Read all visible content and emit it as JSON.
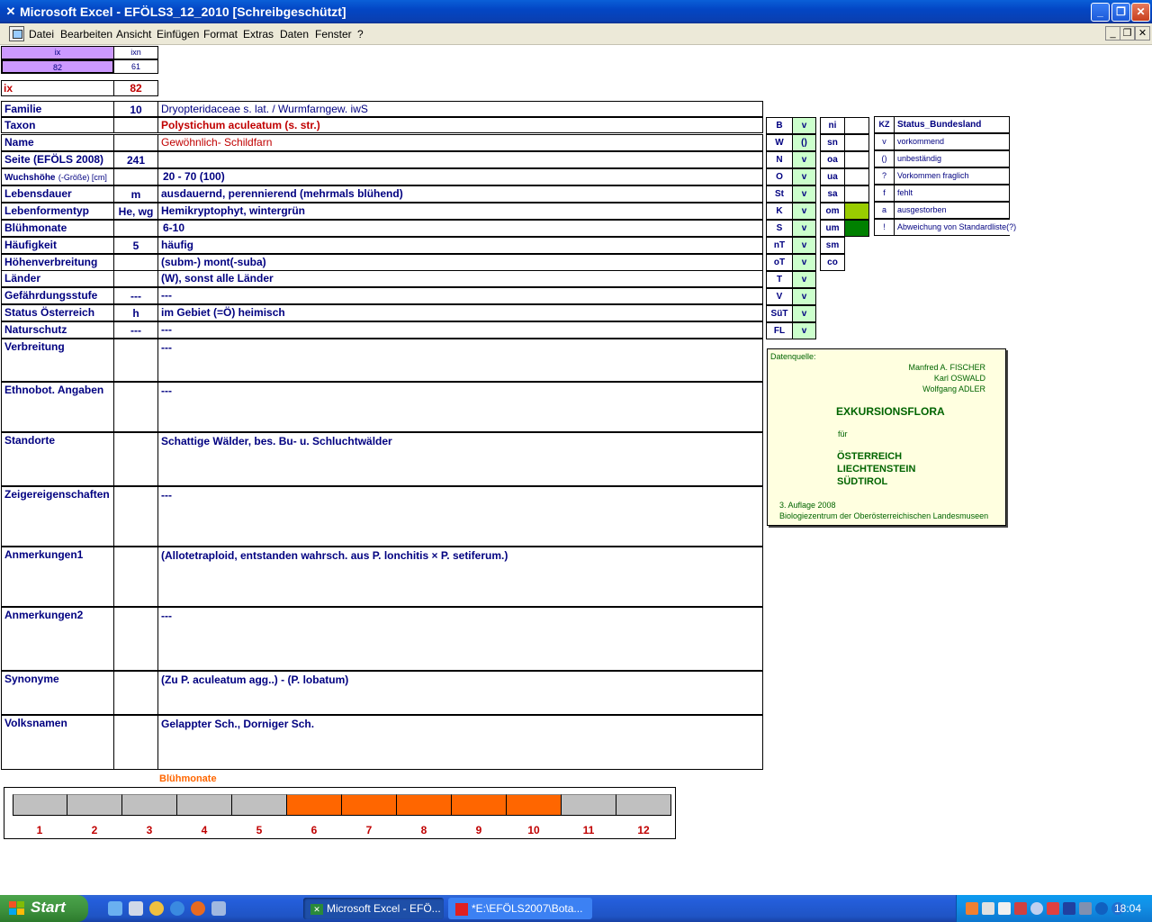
{
  "window": {
    "title": "Microsoft Excel - EFÖLS3_12_2010  [Schreibgeschützt]"
  },
  "menu": [
    "Datei",
    "Bearbeiten",
    "Ansicht",
    "Einfügen",
    "Format",
    "Extras",
    "Daten",
    "Fenster",
    "?"
  ],
  "top_cells": {
    "ix_head": "ix",
    "ixn_head": "ixn",
    "ix_val": "82",
    "ixn_val": "61",
    "ix_label": "ix",
    "ix_big": "82"
  },
  "rows": [
    {
      "label": "Familie",
      "code": "10",
      "value": "Dryopteridaceae s. lat.  /  Wurmfarngew. iwS"
    },
    {
      "label": "Taxon",
      "code": "",
      "value": "Polystichum aculeatum (s. str.)"
    },
    {
      "label": "Name",
      "code": "",
      "value": "Gewöhnlich- Schildfarn"
    },
    {
      "label": "Seite (EFÖLS 2008)",
      "code": "241",
      "value": ""
    },
    {
      "label": "Wuchshöhe",
      "label_suffix": "(-Größe) [cm]",
      "code": "",
      "value": "20 - 70 (100)"
    },
    {
      "label": "Lebensdauer",
      "code": "m",
      "value": "ausdauernd, perennierend (mehrmals blühend)"
    },
    {
      "label": "Lebenformentyp",
      "code": "He, wg",
      "value": "Hemikryptophyt, wintergrün"
    },
    {
      "label": "Blühmonate",
      "code": "",
      "value": "6-10"
    },
    {
      "label": "Häufigkeit",
      "code": "5",
      "value": "häufig"
    },
    {
      "label": "Höhenverbreitung",
      "code": "",
      "value": "(subm-) mont(-suba)"
    },
    {
      "label": "Länder",
      "code": "",
      "value": "(W), sonst alle Länder"
    },
    {
      "label": "Gefährdungsstufe",
      "code": "---",
      "value": "---"
    },
    {
      "label": "Status Österreich",
      "code": "h",
      "value": "im Gebiet (=Ö) heimisch"
    },
    {
      "label": "Naturschutz",
      "code": "---",
      "value": "---"
    },
    {
      "label": "Verbreitung",
      "code": "",
      "value": "---"
    },
    {
      "label": "Ethnobot. Angaben",
      "code": "",
      "value": "---"
    },
    {
      "label": "Standorte",
      "code": "",
      "value": "Schattige Wälder, bes. Bu- u. Schluchtwälder"
    },
    {
      "label": "Zeigereigenschaften",
      "code": "",
      "value": "---"
    },
    {
      "label": "Anmerkungen1",
      "code": "",
      "value": "(Allotetraploid, entstanden wahrsch. aus P. lonchitis × P. setiferum.)"
    },
    {
      "label": "Anmerkungen2",
      "code": "",
      "value": "---"
    },
    {
      "label": "Synonyme",
      "code": "",
      "value": "(Zu P. aculeatum agg..) - (P. lobatum)"
    },
    {
      "label": "Volksnamen",
      "code": "",
      "value": "Gelappter Sch., Dorniger Sch."
    }
  ],
  "status_grid_left": [
    {
      "k": "B",
      "v": "v"
    },
    {
      "k": "W",
      "v": "()"
    },
    {
      "k": "N",
      "v": "v"
    },
    {
      "k": "O",
      "v": "v"
    },
    {
      "k": "St",
      "v": "v"
    },
    {
      "k": "K",
      "v": "v"
    },
    {
      "k": "S",
      "v": "v"
    },
    {
      "k": "nT",
      "v": "v"
    },
    {
      "k": "oT",
      "v": "v"
    },
    {
      "k": "T",
      "v": "v"
    },
    {
      "k": "V",
      "v": "v"
    },
    {
      "k": "SüT",
      "v": "v"
    },
    {
      "k": "FL",
      "v": "v"
    }
  ],
  "status_grid_mid": [
    "ni",
    "sn",
    "oa",
    "ua",
    "sa",
    "om",
    "um",
    "sm",
    "co"
  ],
  "status_colors": {
    "om": "#99cc00",
    "um": "#008000"
  },
  "legend": {
    "head_k": "KZ",
    "head_v": "Status_Bundesland",
    "items": [
      {
        "k": "v",
        "v": "vorkommend"
      },
      {
        "k": "()",
        "v": "unbeständig"
      },
      {
        "k": "?",
        "v": "Vorkommen fraglich"
      },
      {
        "k": "f",
        "v": "fehlt"
      },
      {
        "k": "a",
        "v": "ausgestorben"
      },
      {
        "k": "!",
        "v": "Abweichung von Standardliste(?)"
      }
    ]
  },
  "datenquelle": {
    "label": "Datenquelle:",
    "authors": [
      "Manfred A. FISCHER",
      "Karl OSWALD",
      "Wolfgang ADLER"
    ],
    "title": "EXKURSIONSFLORA",
    "fuer": "für",
    "countries": [
      "ÖSTERREICH",
      "LIECHTENSTEIN",
      "SÜDTIROL"
    ],
    "edition": "3. Auflage 2008",
    "publisher": "Biologiezentrum der Oberösterreichischen Landesmuseen"
  },
  "chart_data": {
    "type": "bar",
    "title": "Blühmonate",
    "categories": [
      "1",
      "2",
      "3",
      "4",
      "5",
      "6",
      "7",
      "8",
      "9",
      "10",
      "11",
      "12"
    ],
    "values": [
      0,
      0,
      0,
      0,
      0,
      1,
      1,
      1,
      1,
      1,
      0,
      0
    ],
    "colors": {
      "active": "#ff6600",
      "inactive": "#c0c0c0"
    }
  },
  "taskbar": {
    "start": "Start",
    "tasks": [
      "Microsoft Excel - EFÖ...",
      "*E:\\EFÖLS2007\\Bota..."
    ],
    "clock": "18:04"
  }
}
